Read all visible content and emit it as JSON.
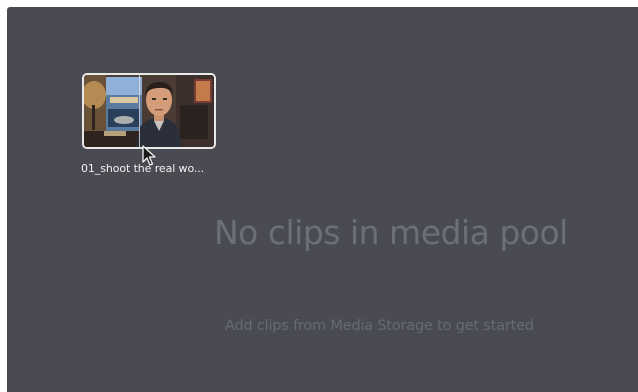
{
  "media_pool": {
    "clips": [
      {
        "name": "01_shoot the real wo...",
        "thumbnail": "man-in-office-thumbnail"
      }
    ],
    "empty_state": {
      "title": "No clips in media pool",
      "subtitle": "Add clips from Media Storage to get started"
    }
  },
  "colors": {
    "panel_background": "#4a4b52",
    "empty_text": "#6c6e78",
    "clip_border": "#e9e9ea"
  },
  "icons": {
    "cursor": "mouse-pointer-icon"
  }
}
